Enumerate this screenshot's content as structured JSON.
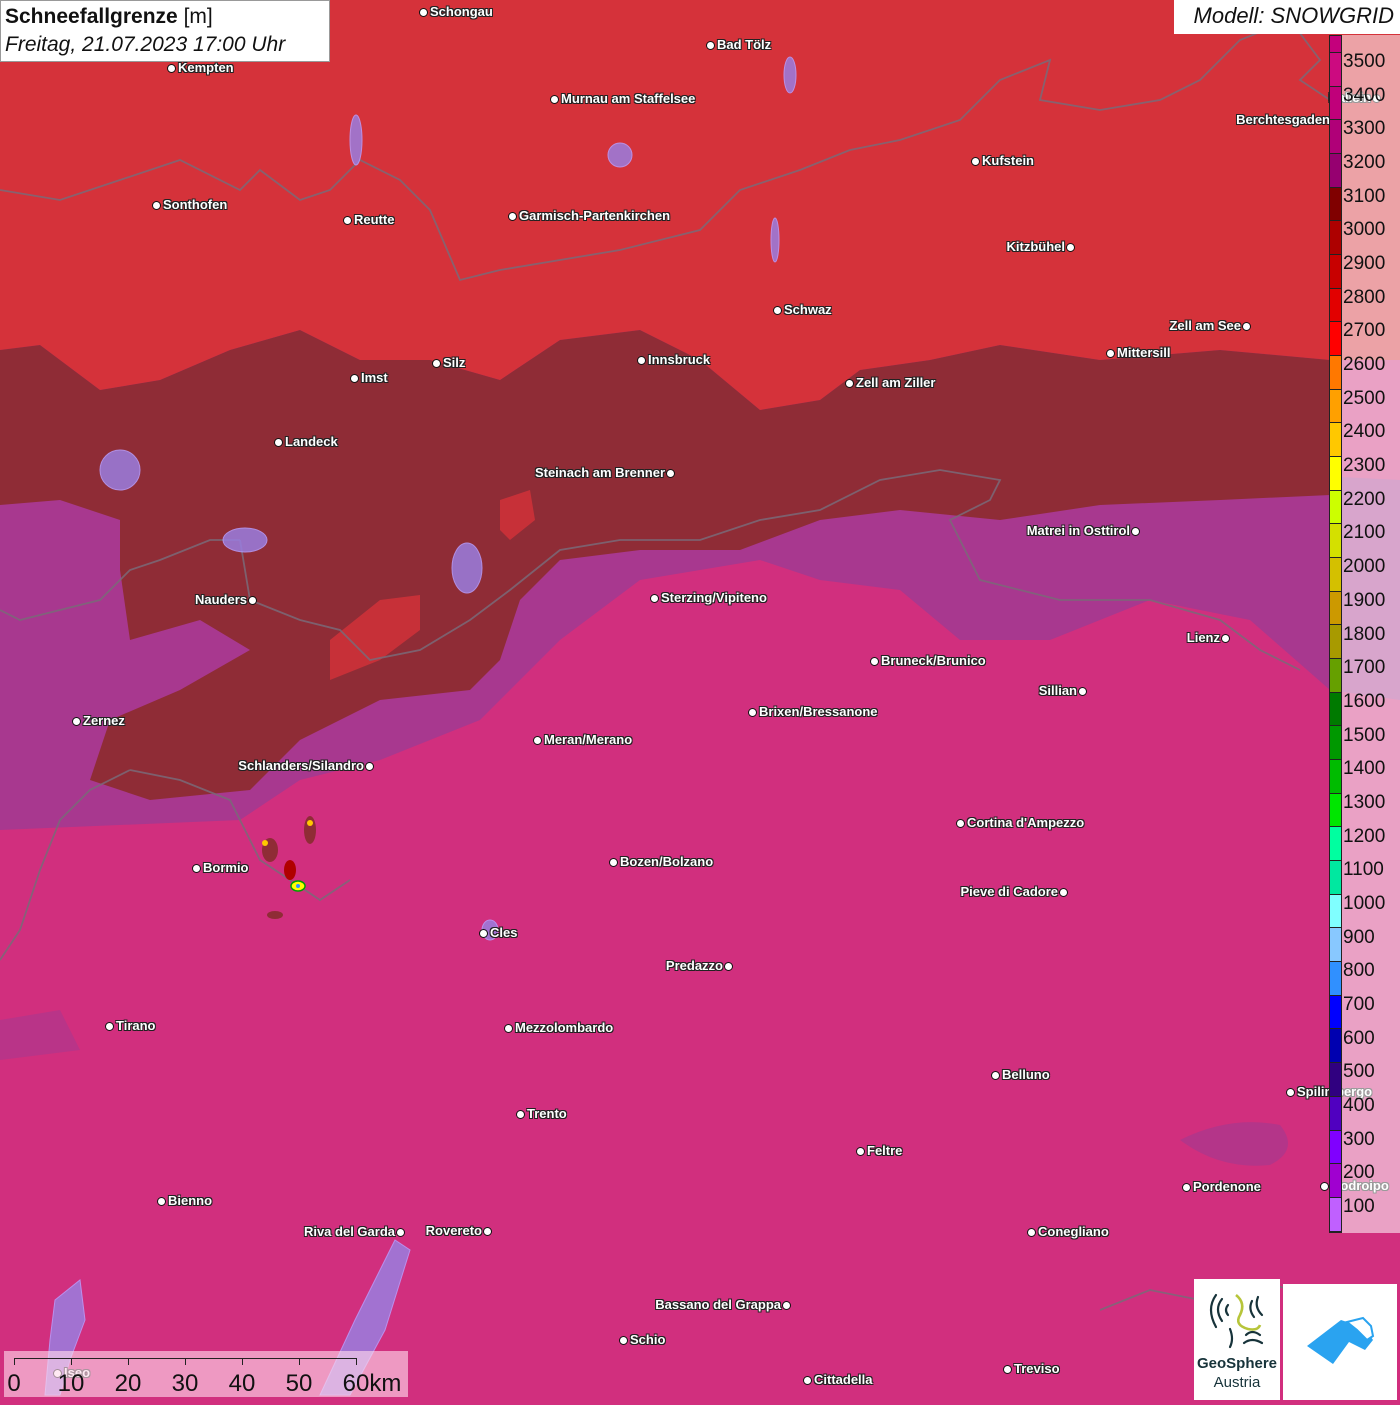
{
  "header": {
    "title": "Schneefallgrenze",
    "unit": "[m]",
    "datetime": "Freitag, 21.07.2023 17:00 Uhr",
    "model": "Modell: SNOWGRID"
  },
  "legend": {
    "top_color": "#c4007c",
    "items": [
      {
        "label": "3500",
        "color": "#cc0a80"
      },
      {
        "label": "3400",
        "color": "#c0007a"
      },
      {
        "label": "3300",
        "color": "#b00078"
      },
      {
        "label": "3200",
        "color": "#960070"
      },
      {
        "label": "3100",
        "color": "#800000"
      },
      {
        "label": "3000",
        "color": "#ad0000"
      },
      {
        "label": "2900",
        "color": "#c80000"
      },
      {
        "label": "2800",
        "color": "#e20000"
      },
      {
        "label": "2700",
        "color": "#ff0000"
      },
      {
        "label": "2600",
        "color": "#ff7800"
      },
      {
        "label": "2500",
        "color": "#ffa000"
      },
      {
        "label": "2400",
        "color": "#ffc800"
      },
      {
        "label": "2300",
        "color": "#ffff00"
      },
      {
        "label": "2200",
        "color": "#ccff00"
      },
      {
        "label": "2100",
        "color": "#d4e000"
      },
      {
        "label": "2000",
        "color": "#d4c000"
      },
      {
        "label": "1900",
        "color": "#cc9900"
      },
      {
        "label": "1800",
        "color": "#a89a00"
      },
      {
        "label": "1700",
        "color": "#66a000"
      },
      {
        "label": "1600",
        "color": "#007a00"
      },
      {
        "label": "1500",
        "color": "#009800"
      },
      {
        "label": "1400",
        "color": "#00bb00"
      },
      {
        "label": "1300",
        "color": "#00e600"
      },
      {
        "label": "1200",
        "color": "#00ffa0"
      },
      {
        "label": "1100",
        "color": "#00e8a0"
      },
      {
        "label": "1000",
        "color": "#80ffff"
      },
      {
        "label": "900",
        "color": "#88c8ff"
      },
      {
        "label": "800",
        "color": "#3090ff"
      },
      {
        "label": "700",
        "color": "#0000ff"
      },
      {
        "label": "600",
        "color": "#0000b0"
      },
      {
        "label": "500",
        "color": "#300080"
      },
      {
        "label": "400",
        "color": "#5000c0"
      },
      {
        "label": "300",
        "color": "#8000ff"
      },
      {
        "label": "200",
        "color": "#a000d0"
      },
      {
        "label": "100",
        "color": "#c060ff"
      }
    ]
  },
  "map_colors": {
    "red_zone": "#d5323a",
    "dark_red_zone": "#8f2c36",
    "purple_zone": "#a8388f",
    "magenta_zone": "#d12f7e",
    "border": "#7a6a78",
    "lake": "#9a7ee0"
  },
  "cities": [
    "Schongau",
    "Kempten",
    "Bad Tölz",
    "Murnau am Staffelsee",
    "Hallein",
    "Berchtesgaden",
    "Kufstein",
    "Sonthofen",
    "Reutte",
    "Garmisch-Partenkirchen",
    "Kitzbühel",
    "Schwaz",
    "Zell am See",
    "Mittersill",
    "Innsbruck",
    "Silz",
    "Imst",
    "Zell am Ziller",
    "Landeck",
    "Steinach am Brenner",
    "Matrei in Osttirol",
    "Nauders",
    "Sterzing/Vipiteno",
    "Lienz",
    "Bruneck/Brunico",
    "Sillian",
    "Brixen/Bressanone",
    "Zernez",
    "Meran/Merano",
    "Schlanders/Silandro",
    "Cortina d'Ampezzo",
    "Bozen/Bolzano",
    "Bormio",
    "Pieve di Cadore",
    "Cles",
    "Predazzo",
    "Tirano",
    "Mezzolombardo",
    "Belluno",
    "Spilimbergo",
    "Trento",
    "Feltre",
    "Pordenone",
    "Codroipo",
    "Bienno",
    "Riva del Garda",
    "Rovereto",
    "Conegliano",
    "Bassano del Grappa",
    "Schio",
    "Iseo",
    "Treviso",
    "Cittadella"
  ],
  "scale": {
    "labels": [
      "0",
      "10",
      "20",
      "30",
      "40",
      "50",
      "60km"
    ]
  },
  "logos": {
    "geosphere_line1": "GeoSphere",
    "geosphere_line2": "Austria",
    "geosphere_icon": "contour-lines-icon",
    "snowgrid_icon": "mountain-snow-icon"
  }
}
